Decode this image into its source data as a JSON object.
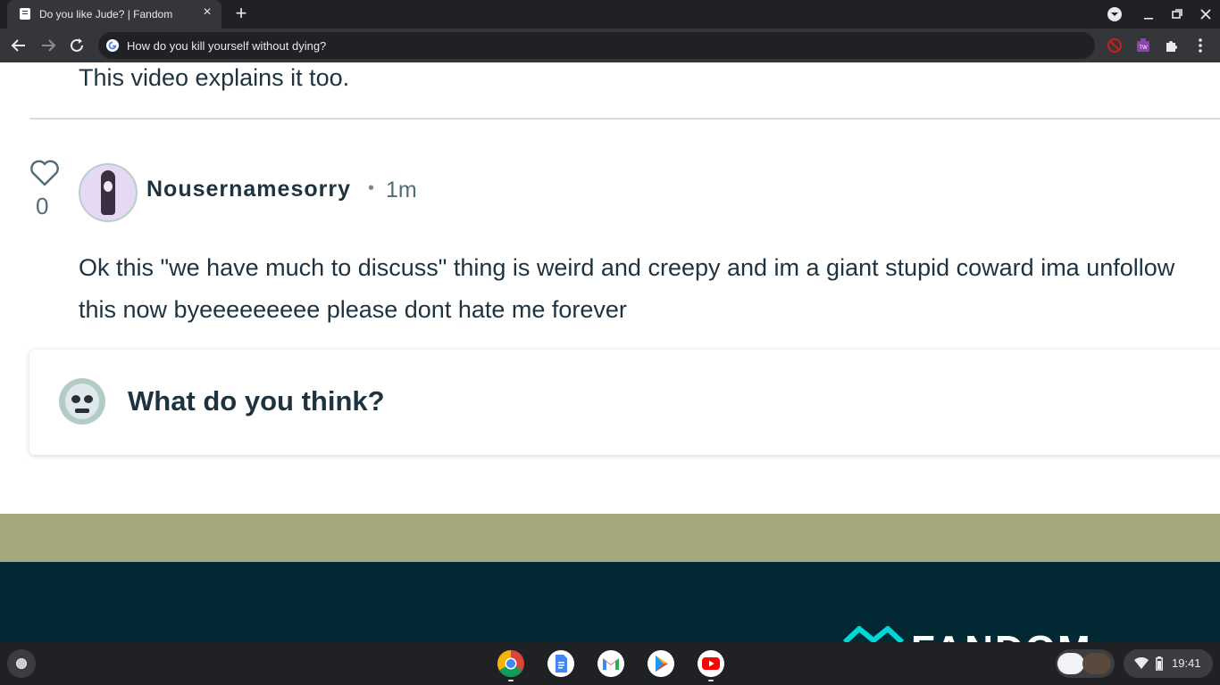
{
  "browser": {
    "tab_title": "Do you like Jude? | Fandom",
    "omnibox_text": "How do you kill yourself without dying?"
  },
  "thread": {
    "previous_comment_tail": "This video explains it too.",
    "comment": {
      "like_count": "0",
      "username": "Nousernamesorry",
      "separator": "•",
      "timestamp": "1m",
      "body": "Ok this \"we have much to discuss\" thing is weird and creepy and im a giant stupid coward ima unfollow this now byeeeeeeeee please dont hate me forever"
    },
    "reply_placeholder": "What do you think?"
  },
  "footer": {
    "brand": "FANDOM"
  },
  "shelf": {
    "apps": [
      "chrome-icon",
      "docs-icon",
      "gmail-icon",
      "play-store-icon",
      "youtube-icon"
    ],
    "clock": "19:41"
  },
  "colors": {
    "text_dark": "#1e3340",
    "olive_band": "#a5a87c",
    "footer_bg": "#022833",
    "fandom_accent": "#00d6d6"
  }
}
